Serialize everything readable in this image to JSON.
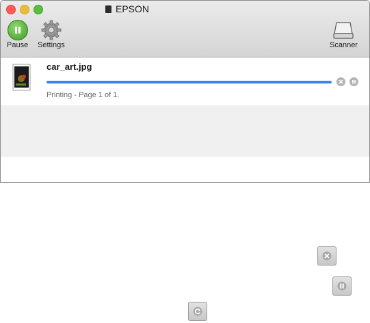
{
  "window": {
    "title": "EPSON",
    "toolbar": {
      "pause_label": "Pause",
      "settings_label": "Settings",
      "scanner_label": "Scanner"
    }
  },
  "job": {
    "filename": "car_art.jpg",
    "progress_fraction": 1.0,
    "status": "Printing - Page 1 of 1."
  },
  "colors": {
    "progress_fill": "#3d84e8",
    "pause_green": "#3e9f25"
  },
  "reference_icons": [
    "cancel-x-icon",
    "pause-icon",
    "refresh-icon"
  ]
}
